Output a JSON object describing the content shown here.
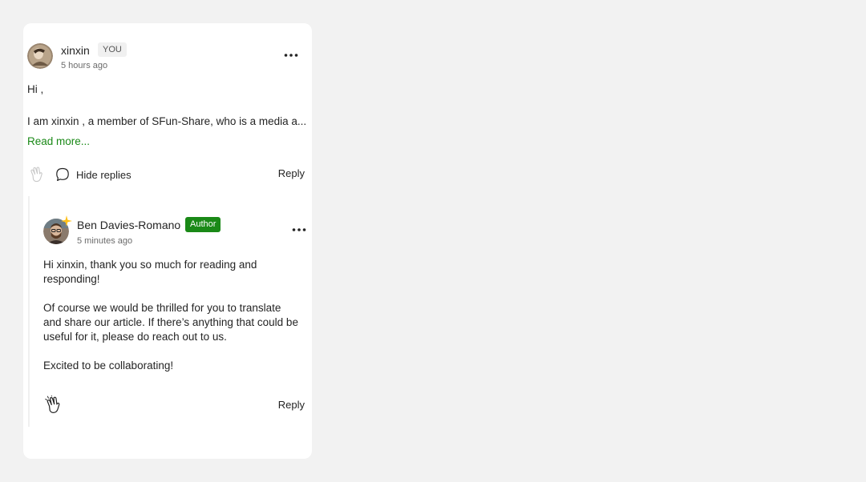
{
  "comment": {
    "author": "xinxin",
    "badge": "YOU",
    "timestamp": "5 hours ago",
    "greeting": "Hi ,",
    "excerpt": "I am xinxin , a member of SFun-Share, who is a media a...",
    "read_more": "Read more...",
    "replies_toggle": "Hide replies",
    "reply_label": "Reply",
    "more_icon": "more-horizontal-icon",
    "clap_icon": "clap-icon",
    "bubble_icon": "speech-bubble-icon"
  },
  "reply": {
    "author": "Ben Davies-Romano",
    "badge": "Author",
    "timestamp": "5 minutes ago",
    "paragraphs": [
      "Hi xinxin, thank you so much for reading and responding!",
      "Of course we would be thrilled for you to translate and share our article. If there’s anything that could be useful for it, please do reach out to us.",
      "Excited to be collaborating!"
    ],
    "reply_label": "Reply",
    "more_icon": "more-horizontal-icon",
    "clap_icon": "clap-icon",
    "star_icon": "star-icon"
  },
  "colors": {
    "accent_green": "#1a8917",
    "text": "#242424",
    "muted": "#6b6b6b",
    "background": "#f2f2f2",
    "card": "#ffffff"
  }
}
